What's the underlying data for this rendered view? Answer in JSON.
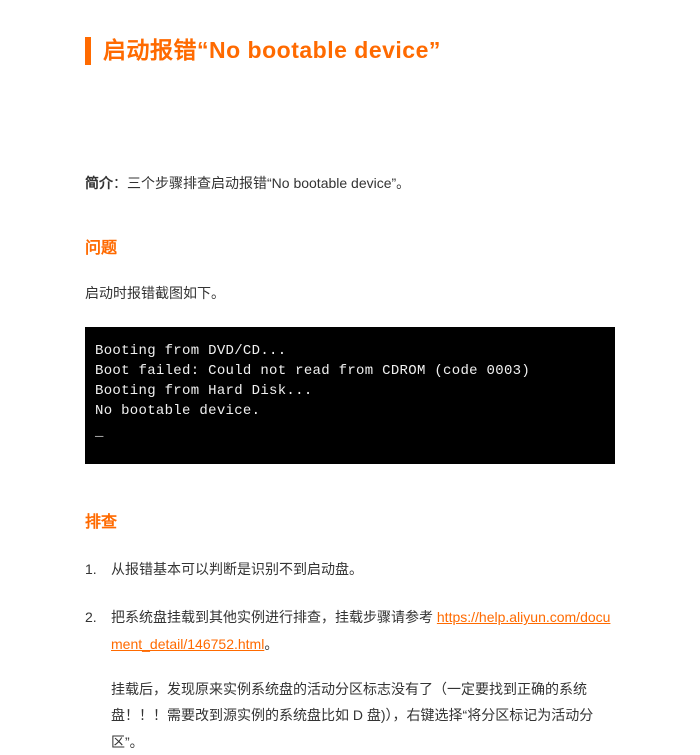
{
  "title": "启动报错“No bootable device”",
  "intro_label": "简介",
  "intro_text": "：三个步骤排查启动报错“No bootable device”。",
  "section_problem": {
    "heading": "问题",
    "body": "启动时报错截图如下。",
    "terminal_lines": "Booting from DVD/CD...\nBoot failed: Could not read from CDROM (code 0003)\nBooting from Hard Disk...\nNo bootable device.\n_"
  },
  "section_investigate": {
    "heading": "排查",
    "items": [
      {
        "text_before": "从报错基本可以判断是识别不到启动盘。",
        "link": "",
        "text_after": ""
      },
      {
        "text_before": "把系统盘挂载到其他实例进行排查，挂载步骤请参考 ",
        "link": "https://help.aliyun.com/document_detail/146752.html",
        "text_after": "。"
      }
    ],
    "sub_paragraph": "挂载后，发现原来实例系统盘的活动分区标志没有了（一定要找到正确的系统盘！！！需要改到源实例的系统盘比如 D 盘)），右键选择“将分区标记为活动分区”。"
  }
}
